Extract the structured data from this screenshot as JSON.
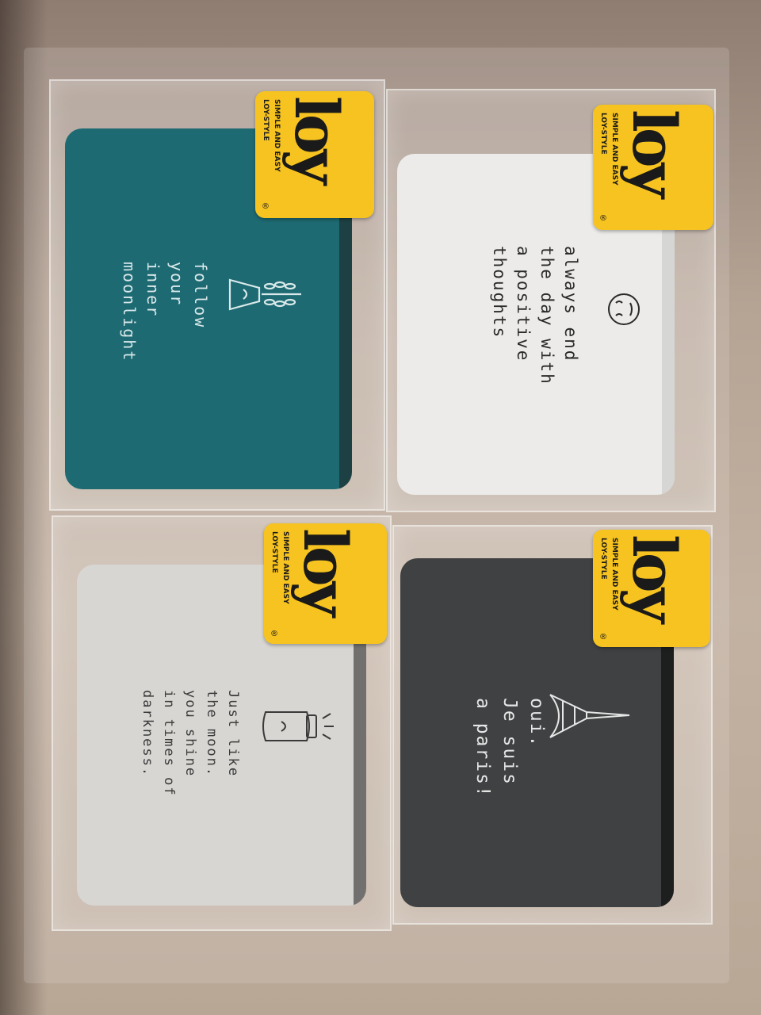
{
  "packages": [
    {
      "id": "teal",
      "pouch_color": "#1e6a73",
      "text_color": "#d9e9ea",
      "icon": "plant-in-pot-icon",
      "lines": [
        "follow",
        "your",
        "inner",
        "moonlight"
      ],
      "label": {
        "brand": "loy",
        "reg": "®",
        "tag_line1": "SIMPLE AND EASY",
        "tag_line2": "LOY-STYLE"
      }
    },
    {
      "id": "white",
      "pouch_color": "#ecebe9",
      "text_color": "#2a2a2a",
      "icon": "smiley-face-icon",
      "lines": [
        "always end",
        "the day with",
        "a positive",
        "thoughts"
      ],
      "label": {
        "brand": "loy",
        "reg": "®",
        "tag_line1": "SIMPLE AND EASY",
        "tag_line2": "LOY-STYLE"
      }
    },
    {
      "id": "light-grey",
      "pouch_color": "#d7d6d3",
      "text_color": "#3a3a3a",
      "icon": "jar-with-moon-icon",
      "lines": [
        "Just like",
        "the moon.",
        "you shine",
        "in times of",
        "darkness."
      ],
      "label": {
        "brand": "loy",
        "reg": "®",
        "tag_line1": "SIMPLE AND EASY",
        "tag_line2": "LOY-STYLE"
      }
    },
    {
      "id": "dark-grey",
      "pouch_color": "#3f4142",
      "text_color": "#e6e6e6",
      "icon": "eiffel-tower-icon",
      "lines": [
        "oui.",
        "Je suis",
        "a paris!"
      ],
      "label": {
        "brand": "loy",
        "reg": "®",
        "tag_line1": "SIMPLE AND EASY",
        "tag_line2": "LOY-STYLE"
      }
    }
  ]
}
